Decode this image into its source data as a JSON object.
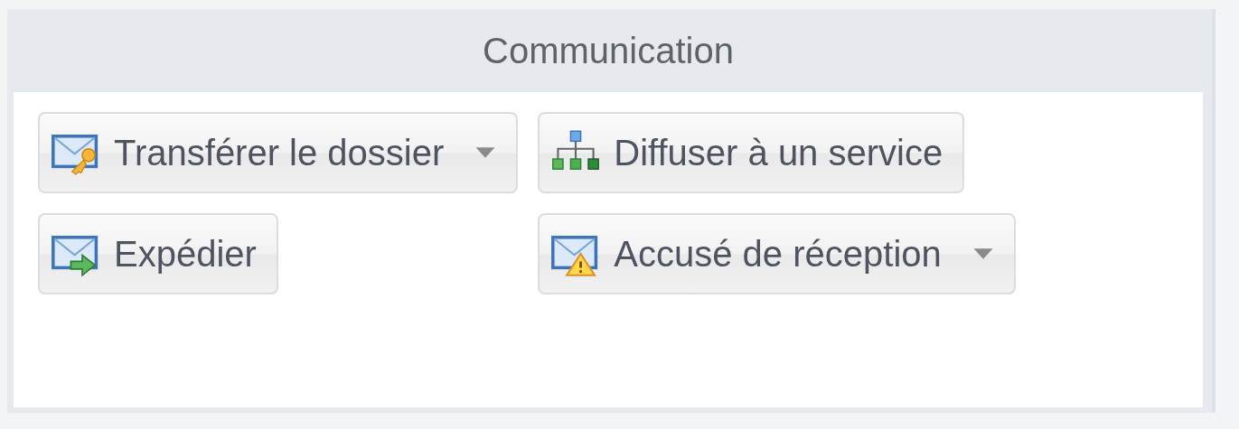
{
  "panel": {
    "title": "Communication"
  },
  "buttons": [
    {
      "label": "Transférer le dossier",
      "dropdown": true
    },
    {
      "label": "Diffuser à un service",
      "dropdown": false
    },
    {
      "label": "Expédier",
      "dropdown": false
    },
    {
      "label": "Accusé de réception",
      "dropdown": true
    }
  ]
}
